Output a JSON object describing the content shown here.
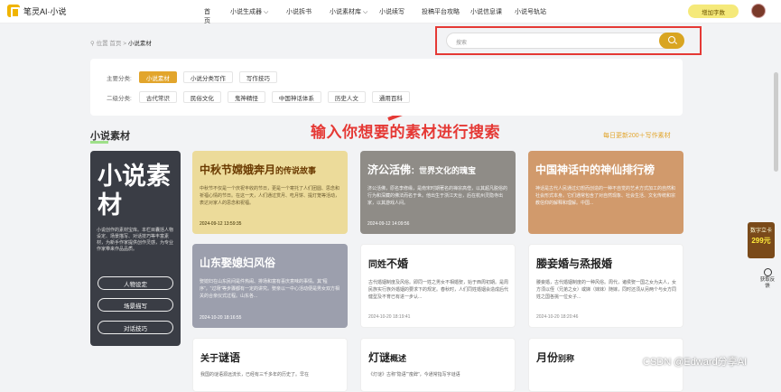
{
  "header": {
    "logo_text": "笔灵AI·小说",
    "nav": [
      "首页",
      "小说生成器",
      "小说拆书",
      "小说素材库",
      "小说续写",
      "投稿平台攻略",
      "小说信息课",
      "小说号轨站"
    ],
    "vip_label": "增加字数"
  },
  "breadcrumb": {
    "prefix": "位置",
    "home": "首页",
    "sep": ">",
    "current": "小说素材"
  },
  "search": {
    "placeholder": "搜索"
  },
  "filters": {
    "primary_label": "主要分类:",
    "primary": [
      "小说素材",
      "小说分类写作",
      "写作技巧"
    ],
    "secondary_label": "二级分类:",
    "secondary": [
      "古代常识",
      "民俗文化",
      "鬼神精怪",
      "中国神话体系",
      "历史人文",
      "通用百科"
    ]
  },
  "annotation": "输入你想要的素材进行搜索",
  "section": {
    "title": "小说素材",
    "daily": "每日更新200＋写作素材"
  },
  "hero": {
    "title": "小说素材",
    "desc": "小说创作的素材宝库。本栏目囊括人物设定、场景描写、对话技巧等丰富素材，为新手作家提供创作灵感，为专业作家带来作品品质。",
    "buttons": [
      "人物设定",
      "场景描写",
      "对话技巧"
    ]
  },
  "cards": [
    {
      "title_main": "中秋节嫦娥奔月",
      "title_sub": "的传说故事",
      "desc": "中秋节不仅是一个庆祝丰收的节日，更是一个寄托了人们团圆、思念和祈福心情的节日。在这一天，人们通过赏月、吃月饼、提灯笼等活动，表达对家人的思念和祝福。",
      "date": "2024-09-12 13:59:35"
    },
    {
      "title_main": "济公活佛",
      "title_sub": "：世界文化的瑰宝",
      "desc": "济公活佛，原名李修缘，是南宋时期著名的禅宗高僧，以其超凡脱俗的行为和深藏的佛法而名于世。他出生于浙江天台，后在杭州灵隐寺出家，以其游戏人间。",
      "date": "2024-09-12 14:09:56"
    },
    {
      "title_main": "中国神话中的神仙排行榜",
      "title_sub": "",
      "desc": "神话是古代人民通过幻想而创造的一种不自觉的艺术方式加工的自然和社会形式本身。它们通常包含了对自然现象、社会生活、文化传统和宗教信仰的解释和理解。中国...",
      "date": ""
    },
    {
      "title_main": "山东娶媳妇风俗",
      "title_sub": "",
      "desc": "娶媳妇在山东民间是件热闹、排场和富有喜庆意味的事情。其“程序”，“过场”等步骤都有一定的讲究。娶亲以一中心活动便是男女双方相关的合亲仪式过程。山东各...",
      "date": "2024-10-20 18:16:55"
    },
    {
      "title_main": "同姓",
      "title_sub": "不婚",
      "desc": "古代婚姻制度及风俗。即同一姓之男女不相婚娶，始于西周初期。是周民族实行族外婚姻的要求下的规定。春秋时，人们同姓婚姻会造成后代健型及不育已有进一步认...",
      "date": "2024-10-20 18:19:41"
    },
    {
      "title_main": "媵妾婚与烝报婚",
      "title_sub": "",
      "desc": "媵妾婚，古代婚姻制度的一种风俗。周代，诸侯娶一国之女为夫人，女方须以侄（兄弟之女）或娣（妹妹）随嫁，同时还须从另两个与女方同姓之国各挑一位女子...",
      "date": "2024-10-20 18:20:46"
    },
    {
      "title_main": "关于",
      "title_sub": "谜语",
      "desc": "我国的谜语源远流长，已经有三千多年的历史了。早在",
      "date": ""
    },
    {
      "title_main": "灯谜",
      "title_sub": "概述",
      "desc": "《灯谜》古称“隐语”“廋辞”，今通常指写字谜语",
      "date": ""
    },
    {
      "title_main": "月份",
      "title_sub": "别称",
      "desc": "",
      "date": ""
    }
  ],
  "side_ad": {
    "line1": "数字立卡",
    "price": "299元"
  },
  "feedback": {
    "label": "获取反馈"
  },
  "watermark": "CSDN @Edward分享AI"
}
